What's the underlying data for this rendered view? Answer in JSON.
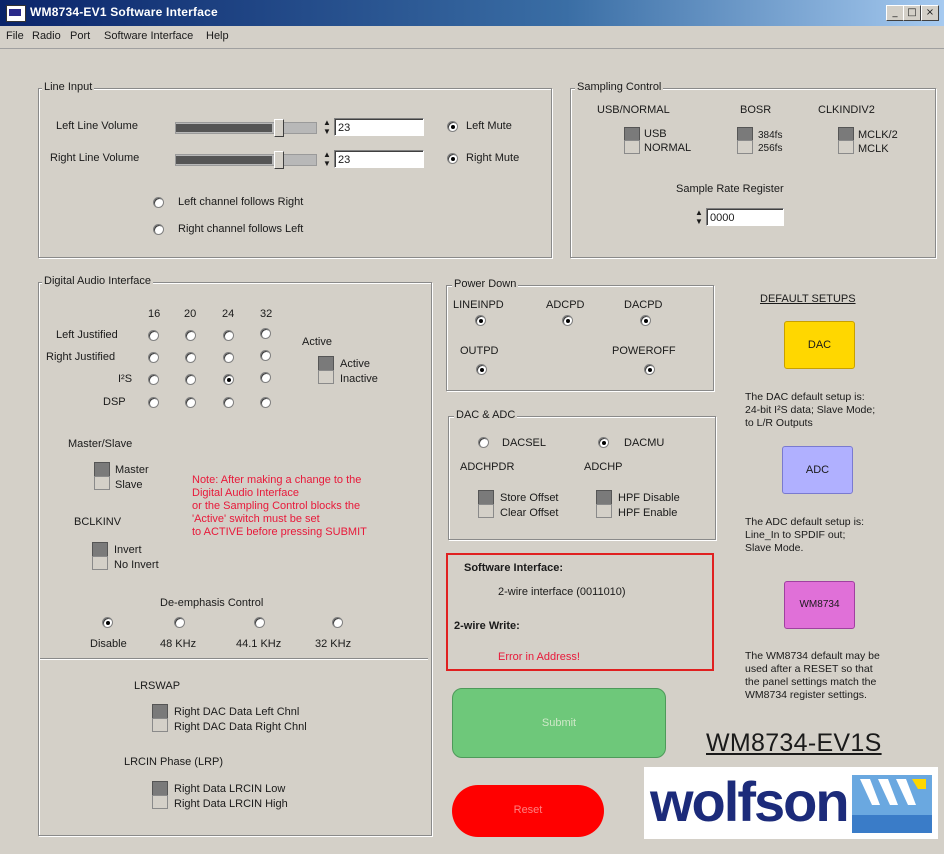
{
  "window": {
    "title": "WM8734-EV1 Software Interface"
  },
  "menu": {
    "items": [
      {
        "label": "File"
      },
      {
        "label": "Radio"
      },
      {
        "label": "Port"
      },
      {
        "label": "Software Interface"
      },
      {
        "label": "Help"
      }
    ]
  },
  "line_input": {
    "title": "Line Input",
    "left_volume_label": "Left Line Volume",
    "right_volume_label": "Right Line Volume",
    "left_volume_value": "23",
    "right_volume_value": "23",
    "left_mute_label": "Left Mute",
    "right_mute_label": "Right Mute",
    "left_follows_right": "Left channel follows Right",
    "right_follows_left": "Right channel follows Left"
  },
  "sampling": {
    "title": "Sampling Control",
    "usb_normal_label": "USB/NORMAL",
    "bosr_label": "BOSR",
    "clkindiv2_label": "CLKINDIV2",
    "usb": "USB",
    "normal": "NORMAL",
    "fs384": "384fs",
    "fs256": "256fs",
    "mclk2": "MCLK/2",
    "mclk": "MCLK",
    "sample_rate_label": "Sample Rate Register",
    "sample_rate_value": "0000"
  },
  "dai": {
    "title": "Digital Audio Interface",
    "bits": [
      "16",
      "20",
      "24",
      "32"
    ],
    "rows": [
      "Left Justified",
      "Right Justified",
      "I²S",
      "DSP"
    ],
    "active_label": "Active",
    "active": "Active",
    "inactive": "Inactive",
    "master_slave_label": "Master/Slave",
    "master": "Master",
    "slave": "Slave",
    "bclkinv_label": "BCLKINV",
    "invert": "Invert",
    "no_invert": "No Invert",
    "note_lines": [
      "Note: After making a change to the",
      "Digital Audio Interface",
      "or the Sampling Control blocks the",
      "'Active' switch must be set",
      "to ACTIVE before pressing SUBMIT"
    ],
    "deemph_label": "De-emphasis Control",
    "deemph_options": [
      "Disable",
      "48 KHz",
      "44.1 KHz",
      "32 KHz"
    ],
    "lrswap_label": "LRSWAP",
    "lrswap_on": "Right DAC Data Left Chnl",
    "lrswap_off": "Right DAC Data Right Chnl",
    "lrp_label": "LRCIN Phase (LRP)",
    "lrp_on": "Right Data LRCIN Low",
    "lrp_off": "Right Data LRCIN High"
  },
  "power_down": {
    "title": "Power Down",
    "linein": "LINEINPD",
    "adc": "ADCPD",
    "dac": "DACPD",
    "out": "OUTPD",
    "poweroff": "POWEROFF"
  },
  "dac_adc": {
    "title": "DAC & ADC",
    "dacsel": "DACSEL",
    "dacmu": "DACMU",
    "adchpdr_label": "ADCHPDR",
    "adchp_label": "ADCHP",
    "store_offset": "Store Offset",
    "clear_offset": "Clear Offset",
    "hpf_disable": "HPF Disable",
    "hpf_enable": "HPF Enable"
  },
  "status": {
    "sw_label": "Software Interface:",
    "sw_value": "2-wire interface (0011010)",
    "write_label": "2-wire Write:",
    "write_value": "Error in Address!"
  },
  "buttons": {
    "submit": "Submit",
    "reset": "Reset"
  },
  "defaults": {
    "title": "DEFAULT SETUPS",
    "dac": "DAC",
    "dac_desc": [
      "The DAC default setup is:",
      "24-bit I²S  data; Slave Mode;",
      "to L/R Outputs"
    ],
    "adc": "ADC",
    "adc_desc": [
      "The ADC default setup is:",
      "Line_In to SPDIF out;",
      "Slave Mode."
    ],
    "wm": "WM8734",
    "wm_desc": [
      "The WM8734 default may be",
      "used after a RESET so that",
      "the panel settings match the",
      "WM8734 register settings."
    ]
  },
  "branding": {
    "model": "WM8734-EV1S",
    "logo": "wolfson"
  },
  "colors": {
    "dac_button": "#ffd700",
    "adc_button": "#b0b0ff",
    "wm_button": "#e070d8",
    "submit": "#6ec87a",
    "reset": "#ff0000",
    "status_border": "#e02020"
  }
}
